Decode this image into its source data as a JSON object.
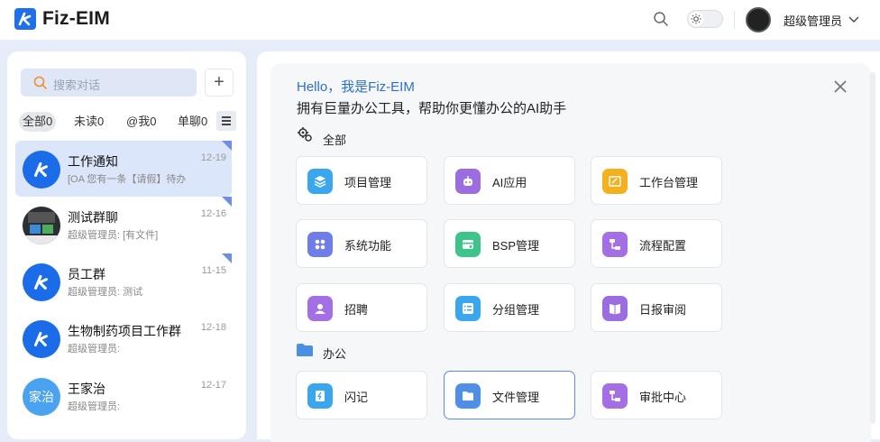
{
  "header": {
    "brand": "Fiz-EIM",
    "user_name": "超级管理员"
  },
  "sidebar": {
    "search_placeholder": "搜索对话",
    "add_label": "+",
    "filters": [
      "全部0",
      "未读0",
      "@我0",
      "单聊0"
    ],
    "conversations": [
      {
        "name": "工作通知",
        "date": "12-19",
        "preview": "[OA 您有一条【请假】待办",
        "selected": true,
        "pinned": true
      },
      {
        "name": "测试群聊",
        "date": "12-16",
        "preview": "超级管理员: [有文件]",
        "selected": false,
        "pinned": true
      },
      {
        "name": "员工群",
        "date": "11-15",
        "preview": "超级管理员: 测试",
        "selected": false,
        "pinned": true
      },
      {
        "name": "生物制药项目工作群",
        "date": "12-18",
        "preview": "超级管理员:",
        "selected": false,
        "pinned": false
      },
      {
        "name": "王家治",
        "date": "12-17",
        "preview": "超级管理员:",
        "avatar_text": "家治",
        "selected": false,
        "pinned": false
      }
    ]
  },
  "main": {
    "greeting": "Hello，我是Fiz-EIM",
    "subtitle": "拥有巨量办公工具，帮助你更懂办公的AI助手",
    "sections": [
      {
        "title": "全部",
        "icon": "gears-icon",
        "items": [
          {
            "label": "项目管理",
            "icon": "layers-icon",
            "color": "#3aa6ee"
          },
          {
            "label": "AI应用",
            "icon": "robot-icon",
            "color": "#9b6de0"
          },
          {
            "label": "工作台管理",
            "icon": "workbench-icon",
            "color": "#f5b01e"
          },
          {
            "label": "系统功能",
            "icon": "modules-icon",
            "color": "#6f7de8"
          },
          {
            "label": "BSP管理",
            "icon": "bsp-icon",
            "color": "#3dc48a"
          },
          {
            "label": "流程配置",
            "icon": "flow-icon",
            "color": "#a46ee4"
          },
          {
            "label": "招聘",
            "icon": "recruit-icon",
            "color": "#a46ee4"
          },
          {
            "label": "分组管理",
            "icon": "group-icon",
            "color": "#3aa6ee"
          },
          {
            "label": "日报审阅",
            "icon": "book-icon",
            "color": "#9b6de0"
          }
        ]
      },
      {
        "title": "办公",
        "icon": "folder-icon",
        "items": [
          {
            "label": "闪记",
            "icon": "note-icon",
            "color": "#3aa6ee"
          },
          {
            "label": "文件管理",
            "icon": "folder-open-icon",
            "color": "#4f8fe6"
          },
          {
            "label": "审批中心",
            "icon": "approval-icon",
            "color": "#a46ee4"
          }
        ]
      }
    ]
  }
}
